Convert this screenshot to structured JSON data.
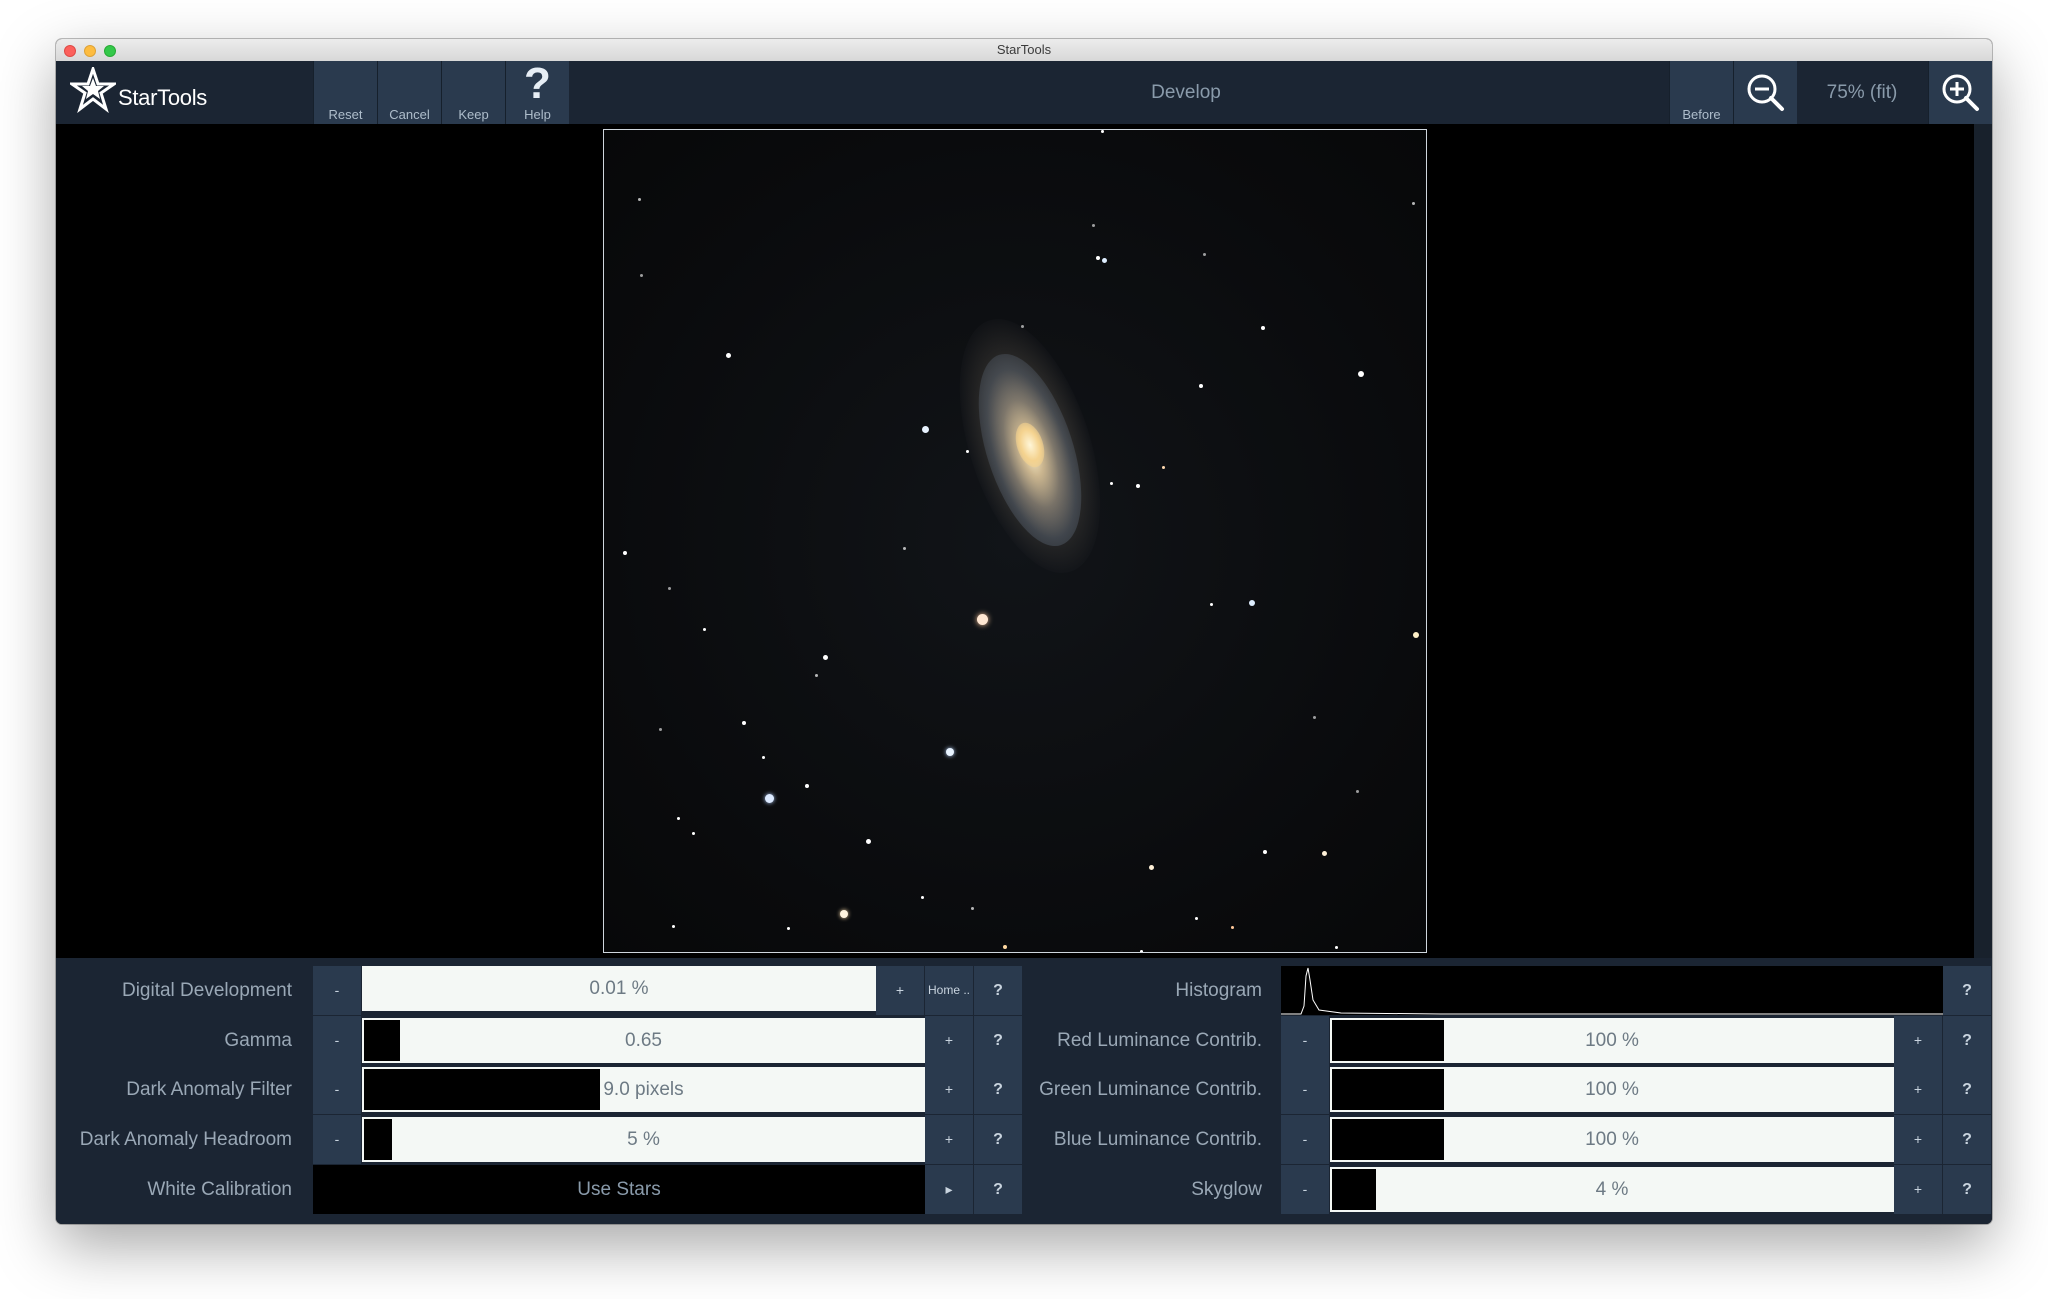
{
  "window": {
    "title": "StarTools"
  },
  "app": {
    "logo_text": "StarTools"
  },
  "toolbar": {
    "buttons": [
      {
        "label": "Reset"
      },
      {
        "label": "Cancel"
      },
      {
        "label": "Keep"
      },
      {
        "label": "Help",
        "glyph": "?"
      }
    ],
    "mode_title": "Develop",
    "before_label": "Before",
    "zoom_label": "75% (fit)"
  },
  "controls": {
    "minus": "-",
    "plus": "+",
    "help": "?",
    "home": "Home ..",
    "arrow": "▸",
    "left": [
      {
        "label": "Digital Development",
        "value": "0.01 %",
        "fill": 0.0
      },
      {
        "label": "Gamma",
        "value": "0.65",
        "fill": 0.065
      },
      {
        "label": "Dark Anomaly Filter",
        "value": "9.0 pixels",
        "fill": 0.43
      },
      {
        "label": "Dark Anomaly Headroom",
        "value": "5 %",
        "fill": 0.05
      },
      {
        "label": "White Calibration",
        "value": "Use Stars"
      }
    ],
    "right": [
      {
        "label": "Histogram"
      },
      {
        "label": "Red Luminance Contrib.",
        "value": "100 %",
        "fill": 0.2
      },
      {
        "label": "Green Luminance Contrib.",
        "value": "100 %",
        "fill": 0.2
      },
      {
        "label": "Blue Luminance Contrib.",
        "value": "100 %",
        "fill": 0.2
      },
      {
        "label": "Skyglow",
        "value": "4 %",
        "fill": 0.08
      }
    ]
  },
  "colors": {
    "toolbar_bg": "#1b2533",
    "button_bg": "#2a3a4e",
    "slider_bg": "#f4f8f5",
    "label_text": "#9aa8b6"
  },
  "icons": {
    "logo": "startools-logo-icon",
    "help": "question-mark-icon",
    "zoom_out": "zoom-out-icon",
    "zoom_in": "zoom-in-icon"
  }
}
